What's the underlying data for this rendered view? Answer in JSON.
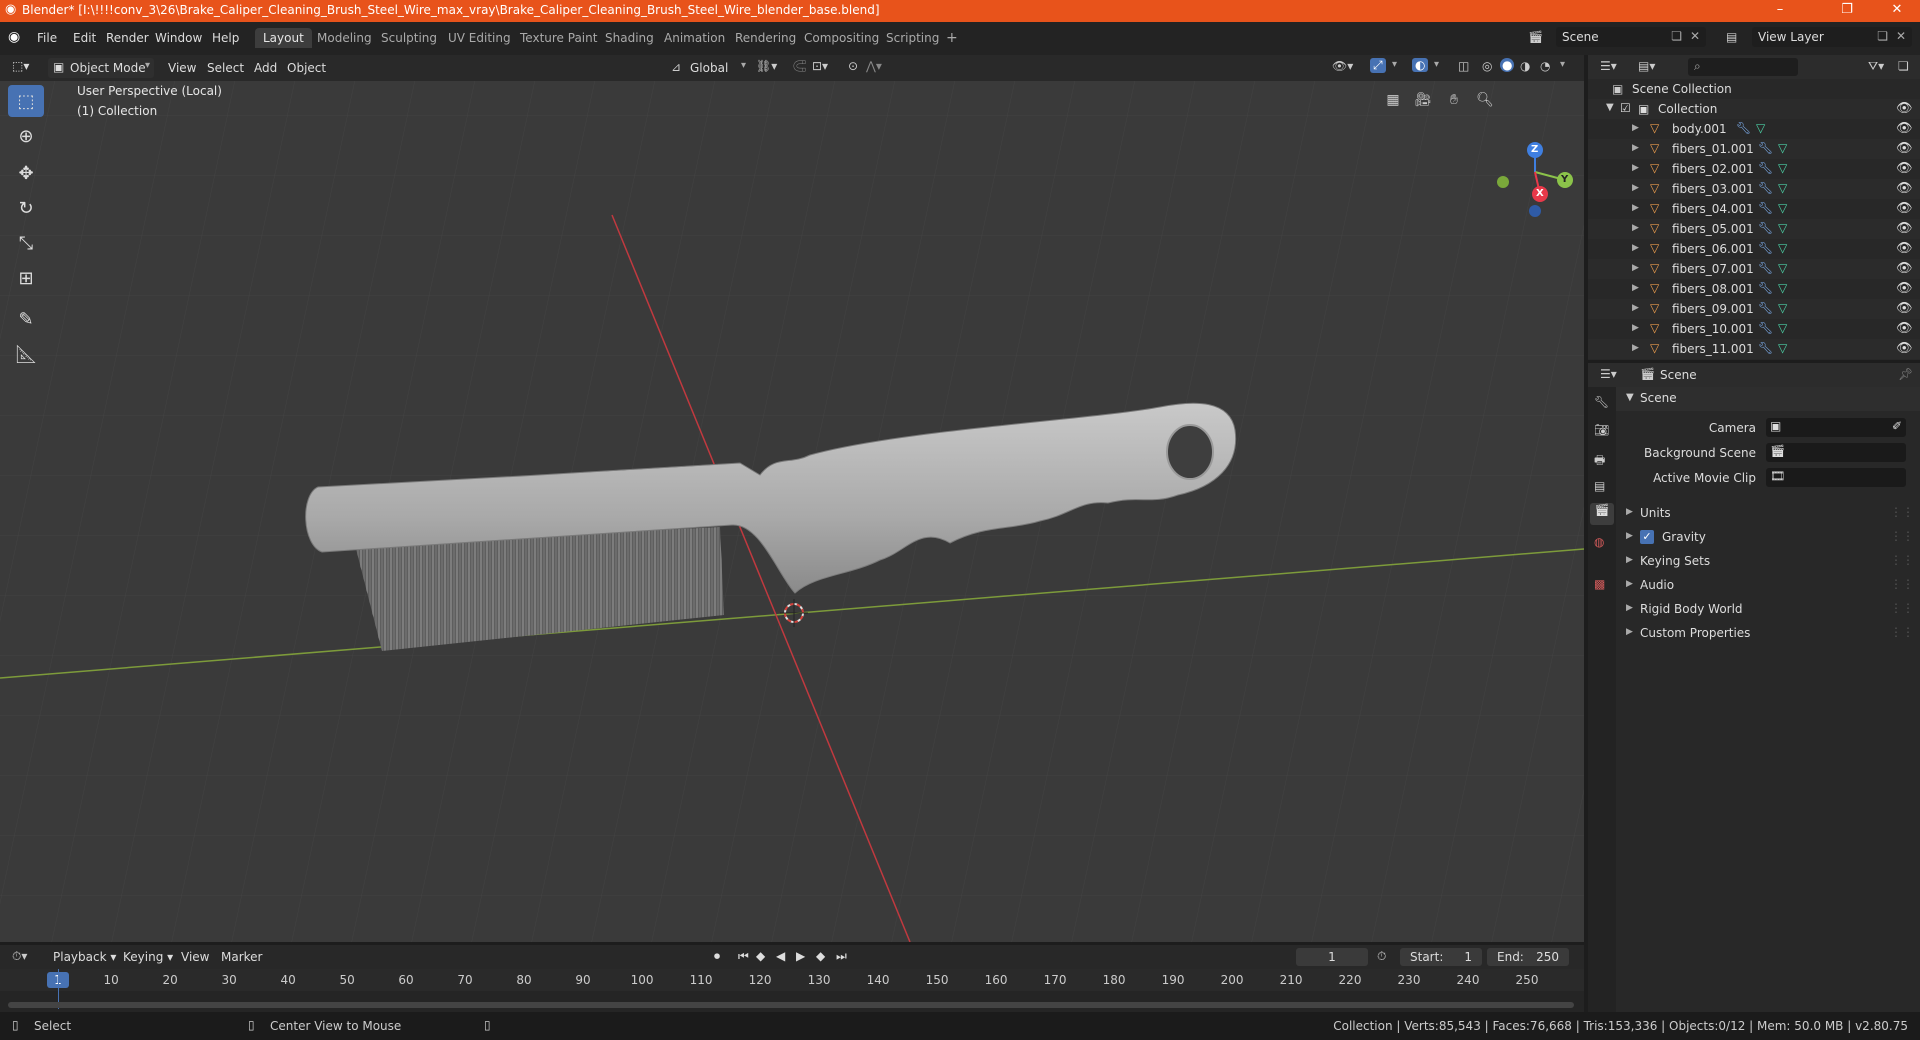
{
  "window": {
    "title": "Blender* [I:\\!!!!conv_3\\26\\Brake_Caliper_Cleaning_Brush_Steel_Wire_max_vray\\Brake_Caliper_Cleaning_Brush_Steel_Wire_blender_base.blend]",
    "minimize": "–",
    "maximize": "❐",
    "close": "✕"
  },
  "menu": [
    "File",
    "Edit",
    "Render",
    "Window",
    "Help"
  ],
  "workspaces": [
    "Layout",
    "Modeling",
    "Sculpting",
    "UV Editing",
    "Texture Paint",
    "Shading",
    "Animation",
    "Rendering",
    "Compositing",
    "Scripting"
  ],
  "workspace_add": "+",
  "scene_field": "Scene",
  "view_layer_field": "View Layer",
  "viewport": {
    "mode": "Object Mode",
    "menus": [
      "View",
      "Select",
      "Add",
      "Object"
    ],
    "transform_orientation": "Global",
    "perspective_label": "User Perspective (Local)",
    "collection_label": "(1) Collection",
    "gizmo": {
      "z": "Z",
      "y": "Y",
      "x": "X"
    }
  },
  "outliner": {
    "root": "Scene Collection",
    "collection": "Collection",
    "objects": [
      "body.001",
      "fibers_01.001",
      "fibers_02.001",
      "fibers_03.001",
      "fibers_04.001",
      "fibers_05.001",
      "fibers_06.001",
      "fibers_07.001",
      "fibers_08.001",
      "fibers_09.001",
      "fibers_10.001",
      "fibers_11.001"
    ]
  },
  "properties": {
    "header": "Scene",
    "section": "Scene",
    "camera_label": "Camera",
    "background_scene_label": "Background Scene",
    "active_movie_clip_label": "Active Movie Clip",
    "panels": [
      "Units",
      "Gravity",
      "Keying Sets",
      "Audio",
      "Rigid Body World",
      "Custom Properties"
    ],
    "gravity_checked": true
  },
  "timeline": {
    "menus": [
      "Playback",
      "Keying",
      "View",
      "Marker"
    ],
    "current_frame": "1",
    "start_label": "Start:",
    "start": "1",
    "end_label": "End:",
    "end": "250",
    "ruler": [
      "1",
      "10",
      "20",
      "30",
      "40",
      "50",
      "60",
      "70",
      "80",
      "90",
      "100",
      "110",
      "120",
      "130",
      "140",
      "150",
      "160",
      "170",
      "180",
      "190",
      "200",
      "210",
      "220",
      "230",
      "240",
      "250"
    ]
  },
  "statusbar": {
    "select": "Select",
    "center_view": "Center View to Mouse",
    "stats": "Collection | Verts:85,543 | Faces:76,668 | Tris:153,336 | Objects:0/12 | Mem: 50.0 MB | v2.80.75"
  },
  "colors": {
    "titlebar": "#e8531b",
    "accent": "#4772b3",
    "x_axis": "#e8394a",
    "y_axis": "#8bc34a",
    "z_axis": "#3f7fe0",
    "mesh_icon": "#e89a4c",
    "modifier_icon": "#7fb1f2",
    "data_icon": "#4cd0a5"
  }
}
